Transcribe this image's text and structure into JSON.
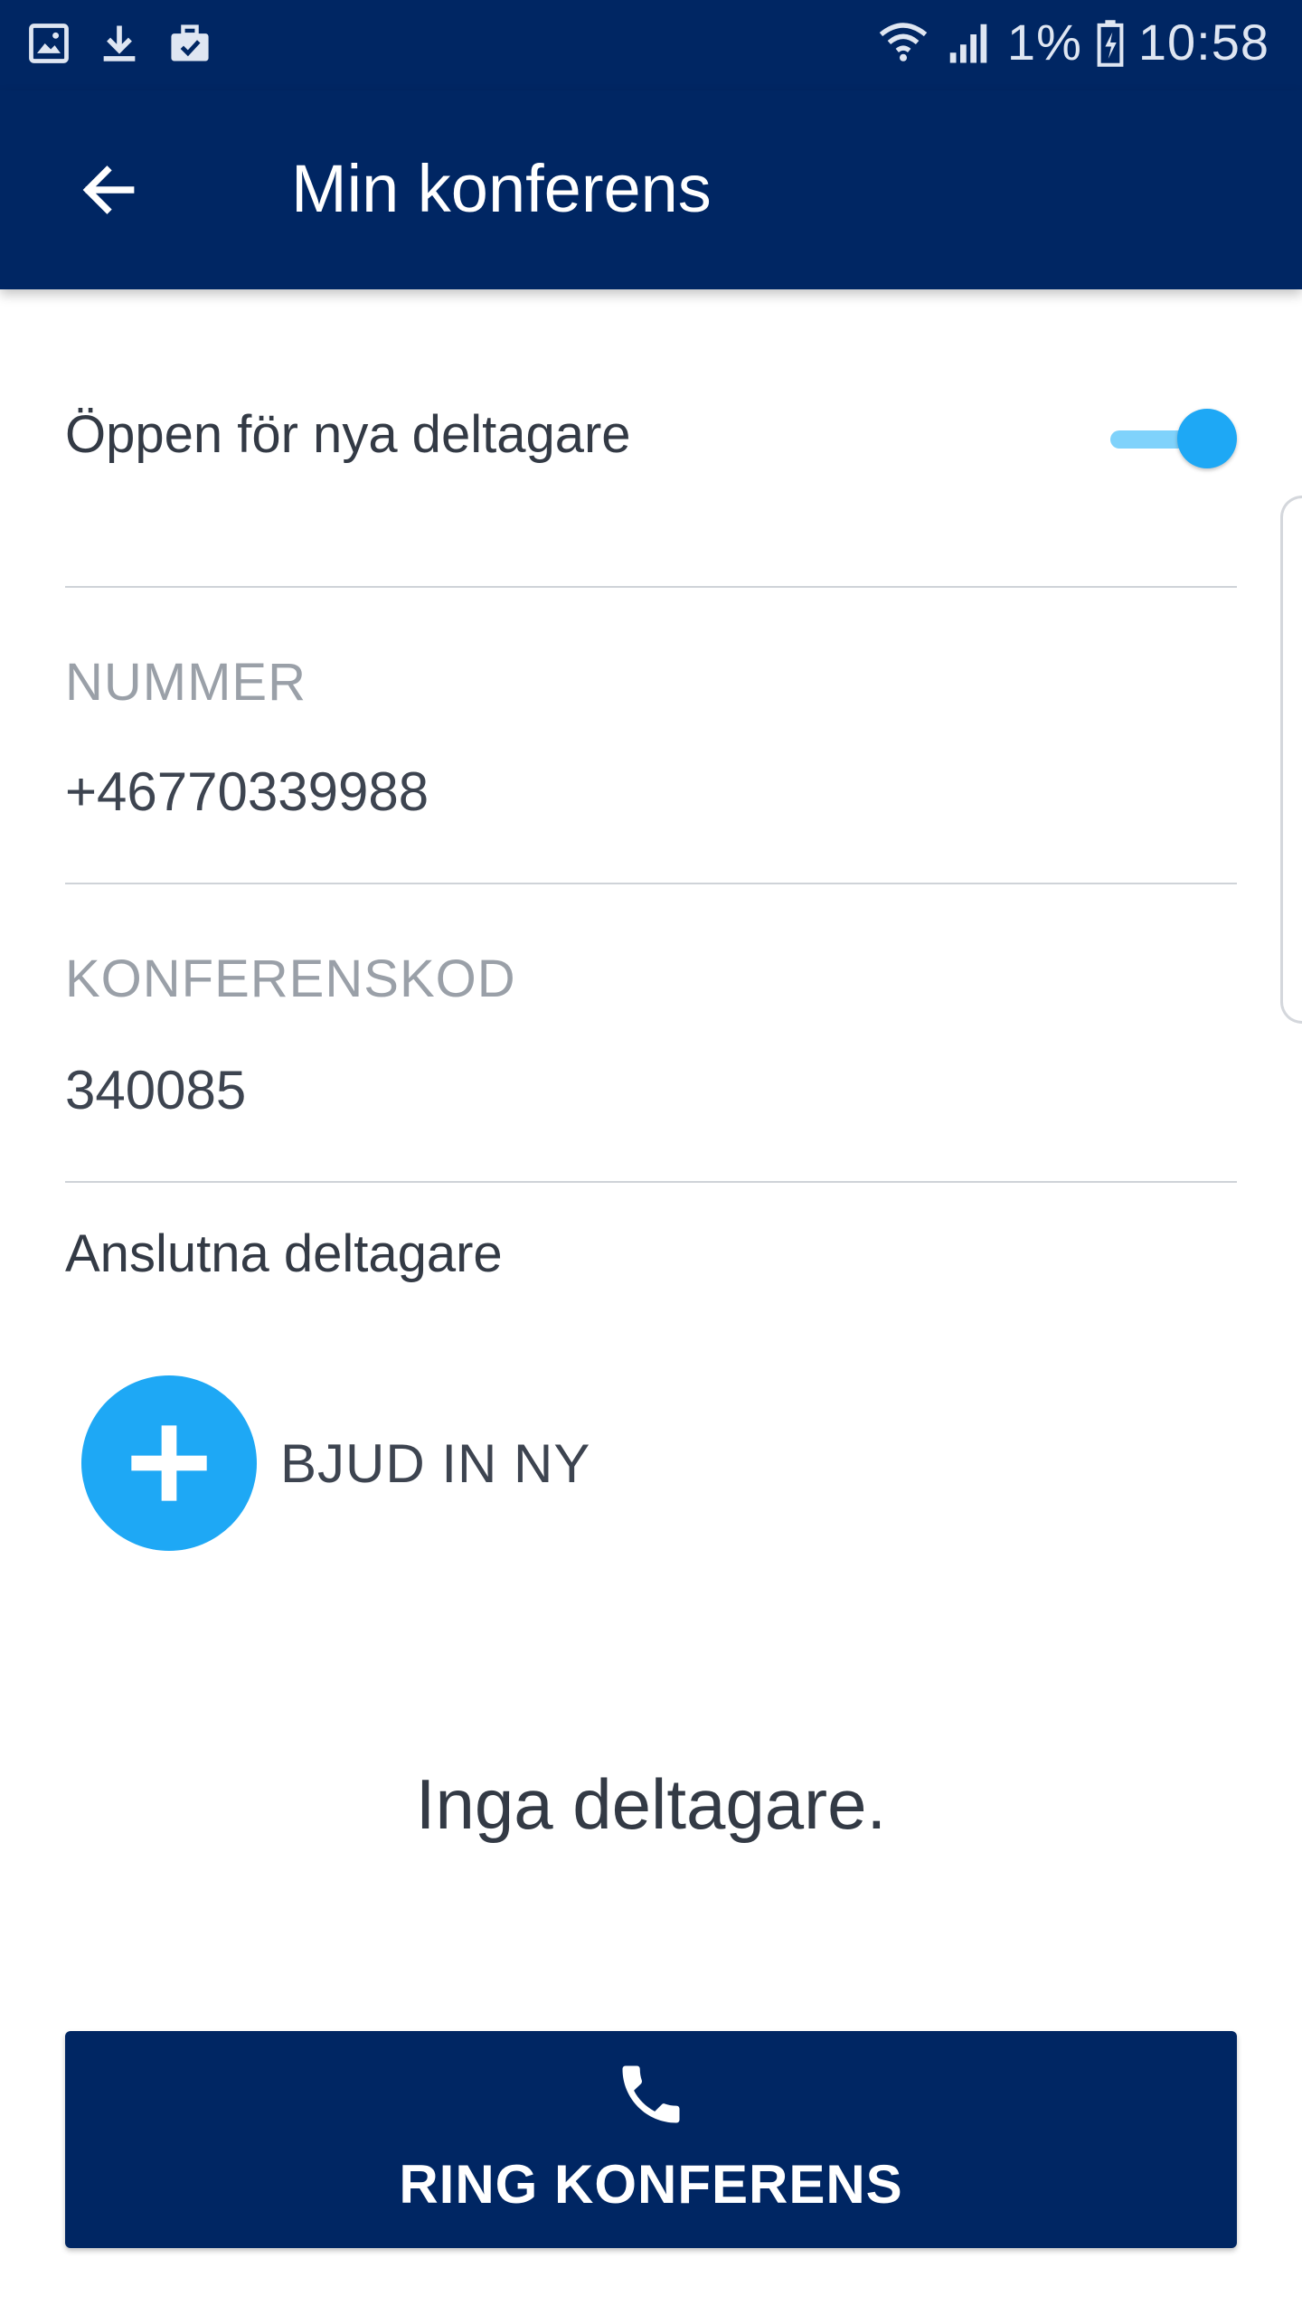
{
  "status_bar": {
    "signal_percent": "1%",
    "time": "10:58",
    "left_icons": [
      "image-notification-icon",
      "download-icon",
      "briefcase-check-icon"
    ],
    "right_icons": [
      "wifi-icon",
      "cellular-signal-icon",
      "battery-charging-icon"
    ]
  },
  "app_bar": {
    "title": "Min konferens",
    "back_icon": "arrow-left-icon"
  },
  "open_toggle": {
    "label": "Öppen för nya deltagare",
    "checked": true
  },
  "number_field": {
    "label": "NUMMER",
    "value": "+46770339988"
  },
  "code_field": {
    "label": "KONFERENSKOD",
    "value": "340085"
  },
  "participants": {
    "title": "Anslutna deltagare",
    "invite_label": "BJUD IN NY",
    "invite_icon": "plus-icon",
    "empty_message": "Inga deltagare."
  },
  "call_button": {
    "label": "RING KONFERENS",
    "icon": "phone-icon"
  },
  "colors": {
    "primary_dark": "#002663",
    "accent": "#1ea8f5",
    "accent_light": "#7fd2fb"
  }
}
